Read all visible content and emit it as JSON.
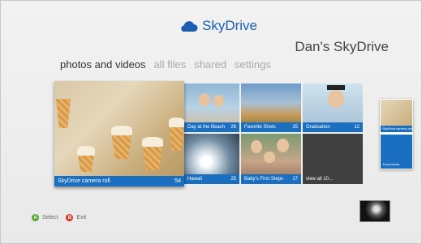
{
  "header": {
    "app_name": "SkyDrive",
    "user_title": "Dan's SkyDrive"
  },
  "pivots": [
    "photos and videos",
    "all files",
    "shared",
    "settings"
  ],
  "tiles": {
    "camera_roll": {
      "label": "SkyDrive camera roll",
      "count": "54"
    },
    "beach": {
      "label": "Day at the Beach",
      "count": "26"
    },
    "favorites": {
      "label": "Favorite Shots",
      "count": "25"
    },
    "graduation": {
      "label": "Graduation",
      "count": "12"
    },
    "hawaii": {
      "label": "Hawaii",
      "count": "25"
    },
    "baby": {
      "label": "Baby's First Steps",
      "count": "17"
    },
    "view_all": {
      "label": "view all 10..."
    }
  },
  "peek": {
    "label": "SkyDrive camera roll",
    "documents": "Documents"
  },
  "footer": {
    "select_key": "A",
    "select_label": "Select",
    "exit_key": "B",
    "exit_label": "Exit"
  },
  "colors": {
    "accent": "#1b6fc0",
    "button_a": "#5aa532",
    "button_b": "#d8352a"
  }
}
